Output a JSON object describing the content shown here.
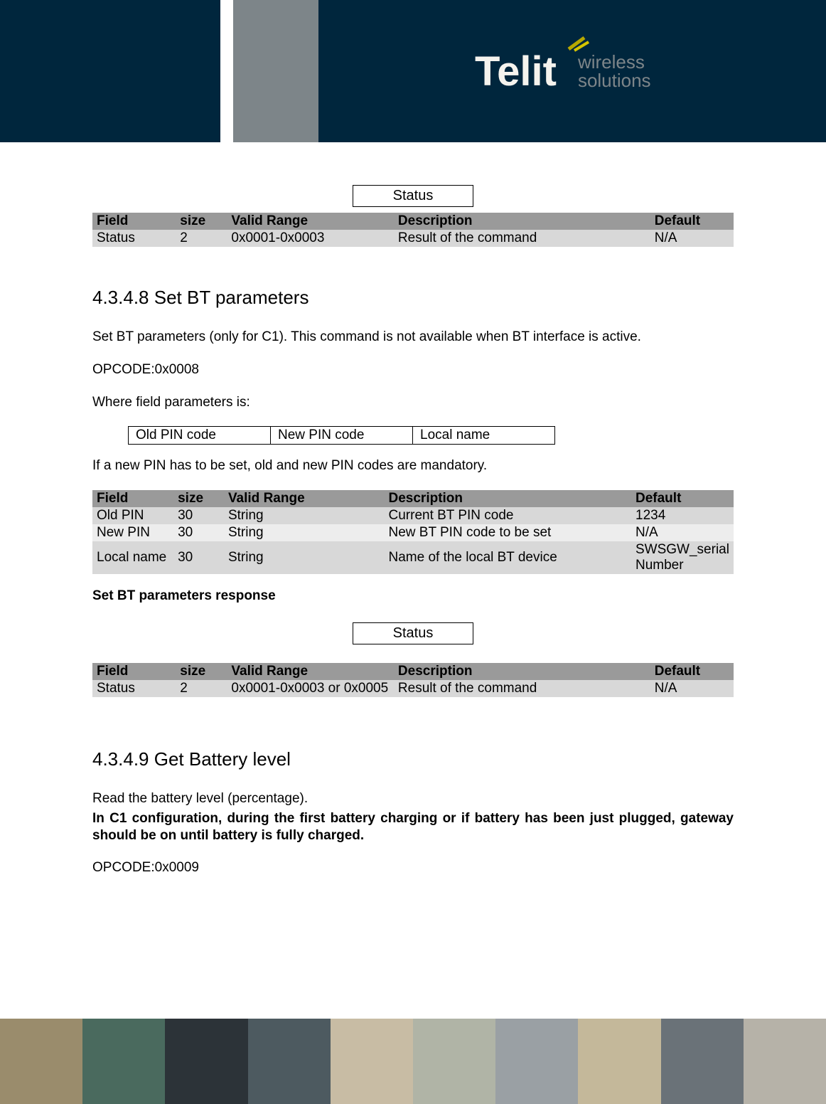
{
  "brand": {
    "name": "Telit",
    "tag1": "wireless",
    "tag2": "solutions"
  },
  "status_box": "Status",
  "tbl_headers": {
    "field": "Field",
    "size": "size",
    "range": "Valid Range",
    "desc": "Description",
    "def": "Default"
  },
  "tbl1_row": {
    "field": "Status",
    "size": "2",
    "range": "0x0001-0x0003",
    "desc": "Result of the command",
    "def": "N/A"
  },
  "s1": {
    "title": "4.3.4.8 Set BT parameters",
    "p1": "Set BT parameters (only for C1). This command is not available when BT interface is active.",
    "p2": "OPCODE:0x0008",
    "p3": "Where field parameters is:",
    "box": {
      "c1": "Old PIN code",
      "c2": "New PIN code",
      "c3": "Local name"
    },
    "p4": "If a new PIN has to be set, old and new PIN codes are mandatory.",
    "rows": [
      {
        "field": "Old PIN",
        "size": "30",
        "range": "String",
        "desc": "Current BT PIN code",
        "def": "1234"
      },
      {
        "field": "New PIN",
        "size": "30",
        "range": "String",
        "desc": "New BT PIN code to be set",
        "def": "N/A"
      },
      {
        "field": "Local name",
        "size": "30",
        "range": "String",
        "desc": "Name of the local BT device",
        "def": "SWSGW_serial Number"
      }
    ],
    "resp_title": "Set  BT  parameters response",
    "resp_row": {
      "field": "Status",
      "size": "2",
      "range": "0x0001-0x0003 or 0x0005",
      "desc": "Result of the command",
      "def": "N/A"
    }
  },
  "s2": {
    "title": "4.3.4.9 Get Battery level",
    "p1": "Read the battery level (percentage).",
    "p2": "In C1 configuration, during the first battery charging or if battery has been just plugged, gateway should be on until battery is fully charged.",
    "p3": "OPCODE:0x0009"
  }
}
